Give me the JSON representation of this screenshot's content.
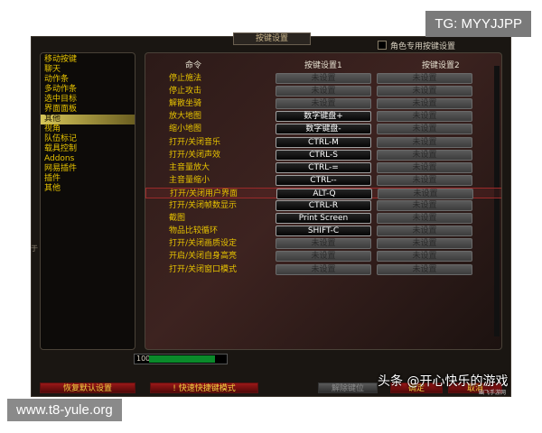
{
  "window_title": "按键设置",
  "character_specific_label": "角色专用按键设置",
  "categories": [
    {
      "label": "移动按键",
      "selected": false
    },
    {
      "label": "聊天",
      "selected": false
    },
    {
      "label": "动作条",
      "selected": false
    },
    {
      "label": "多动作条",
      "selected": false
    },
    {
      "label": "选中目标",
      "selected": false
    },
    {
      "label": "界面面板",
      "selected": false
    },
    {
      "label": "其他",
      "selected": true
    },
    {
      "label": "视角",
      "selected": false
    },
    {
      "label": "队伍标记",
      "selected": false
    },
    {
      "label": "载具控制",
      "selected": false
    },
    {
      "label": "Addons",
      "selected": false
    },
    {
      "label": "网易插件",
      "selected": false
    },
    {
      "label": "插件",
      "selected": false
    },
    {
      "label": "其他",
      "selected": false
    }
  ],
  "left_edge_text": "于",
  "headers": {
    "command": "命令",
    "key1": "按键设置1",
    "key2": "按键设置2"
  },
  "bindings": [
    {
      "command": "停止施法",
      "key1": "未设置",
      "key2": "未设置"
    },
    {
      "command": "停止攻击",
      "key1": "未设置",
      "key2": "未设置"
    },
    {
      "command": "解散坐骑",
      "key1": "未设置",
      "key2": "未设置"
    },
    {
      "command": "放大地图",
      "key1": "数字键盘+",
      "key2": "未设置"
    },
    {
      "command": "缩小地图",
      "key1": "数字键盘-",
      "key2": "未设置"
    },
    {
      "command": "打开/关闭音乐",
      "key1": "CTRL-M",
      "key2": "未设置"
    },
    {
      "command": "打开/关闭声效",
      "key1": "CTRL-S",
      "key2": "未设置"
    },
    {
      "command": "主音量放大",
      "key1": "CTRL-=",
      "key2": "未设置"
    },
    {
      "command": "主音量缩小",
      "key1": "CTRL--",
      "key2": "未设置"
    },
    {
      "command": "打开/关闭用户界面",
      "key1": "ALT-Q",
      "key2": "未设置"
    },
    {
      "command": "打开/关闭帧数显示",
      "key1": "CTRL-R",
      "key2": "未设置"
    },
    {
      "command": "截图",
      "key1": "Print Screen",
      "key2": "未设置"
    },
    {
      "command": "物品比较循环",
      "key1": "SHIFT-C",
      "key2": "未设置"
    },
    {
      "command": "打开/关闭画质设定",
      "key1": "未设置",
      "key2": "未设置"
    },
    {
      "command": "开启/关闭自身高亮",
      "key1": "未设置",
      "key2": "未设置"
    },
    {
      "command": "打开/关闭窗口模式",
      "key1": "未设置",
      "key2": "未设置"
    }
  ],
  "highlight_row_index": 9,
  "progress": {
    "label": "100",
    "fraction": 0.85
  },
  "buttons": {
    "restore_defaults": "恢复默认设置",
    "quick_bind": "快速快捷键模式",
    "unbind": "解除键位",
    "confirm": "确定",
    "cancel": "取消"
  },
  "watermarks": {
    "top_right": "TG: MYYJJPP",
    "bottom_left": "www.t8-yule.org",
    "toutiao": "头条 @开心快乐的游戏",
    "small": "幽飞手游网"
  },
  "colors": {
    "category_text": "#e7c300",
    "command_text": "#e7c300",
    "button_red": "#9a1818",
    "progress_green": "#0a8a2a"
  }
}
